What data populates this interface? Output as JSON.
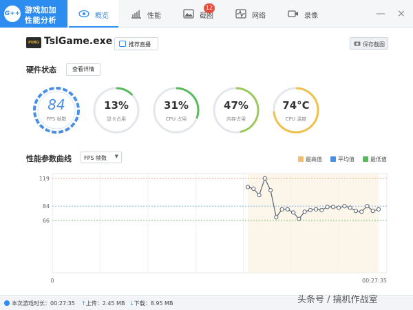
{
  "app": {
    "logo_badge": "G++",
    "logo_line1": "游戏加加",
    "logo_line2": "性能分析"
  },
  "tabs": [
    {
      "label": "概览",
      "icon": "eye-icon",
      "active": true
    },
    {
      "label": "性能",
      "icon": "bar-chart-icon",
      "active": false
    },
    {
      "label": "截图",
      "icon": "image-icon",
      "active": false,
      "badge": "12"
    },
    {
      "label": "网络",
      "icon": "pulse-icon",
      "active": false
    },
    {
      "label": "录像",
      "icon": "video-icon",
      "active": false
    }
  ],
  "window": {
    "minimize": "—",
    "close": "×"
  },
  "header": {
    "game_icon_text": "PUBG",
    "game_title": "TslGame.exe",
    "live_button": "推荐直播",
    "screenshot_button": "保存截图"
  },
  "hardware": {
    "title": "硬件状态",
    "detail_button": "查看详情",
    "gauges": [
      {
        "value": "84",
        "label": "FPS 帧数",
        "fill": 1.0,
        "color": "#4a90e2",
        "style": "dashed"
      },
      {
        "value": "13%",
        "label": "显卡占用",
        "fill": 0.13,
        "color": "#5cb85c"
      },
      {
        "value": "31%",
        "label": "CPU 占用",
        "fill": 0.31,
        "color": "#5cb85c"
      },
      {
        "value": "47%",
        "label": "内存占用",
        "fill": 0.47,
        "color": "#9bc95b"
      },
      {
        "value": "74°C",
        "label": "CPU 温度",
        "fill": 0.74,
        "color": "#f0c04a"
      }
    ]
  },
  "performance": {
    "title": "性能参数曲线",
    "metric_selected": "FPS 帧数",
    "legend": [
      {
        "label": "最高值",
        "color": "#f0c070"
      },
      {
        "label": "平均值",
        "color": "#4a90e2"
      },
      {
        "label": "最低值",
        "color": "#5cb85c"
      }
    ]
  },
  "chart_data": {
    "type": "line",
    "x_start_label": "0",
    "x_end_label": "00:27:35",
    "y_ticks": [
      119,
      84,
      66
    ],
    "ylim": [
      0,
      125
    ],
    "max": 119,
    "avg": 84,
    "min": 66,
    "series": [
      {
        "values": [
          108,
          106,
          98,
          119,
          104,
          70,
          80,
          80,
          76,
          68,
          77,
          79,
          80,
          79,
          83,
          83,
          82,
          84,
          82,
          78,
          77,
          84,
          78,
          80
        ]
      }
    ]
  },
  "status": {
    "session_label": "本次游戏时长：",
    "session_value": "00:27:35",
    "upload_label": "上传：",
    "upload_value": "2.45 MB",
    "download_label": "下载：",
    "download_value": "8.95 MB"
  },
  "watermark": "头条号 / 搞机作战室"
}
